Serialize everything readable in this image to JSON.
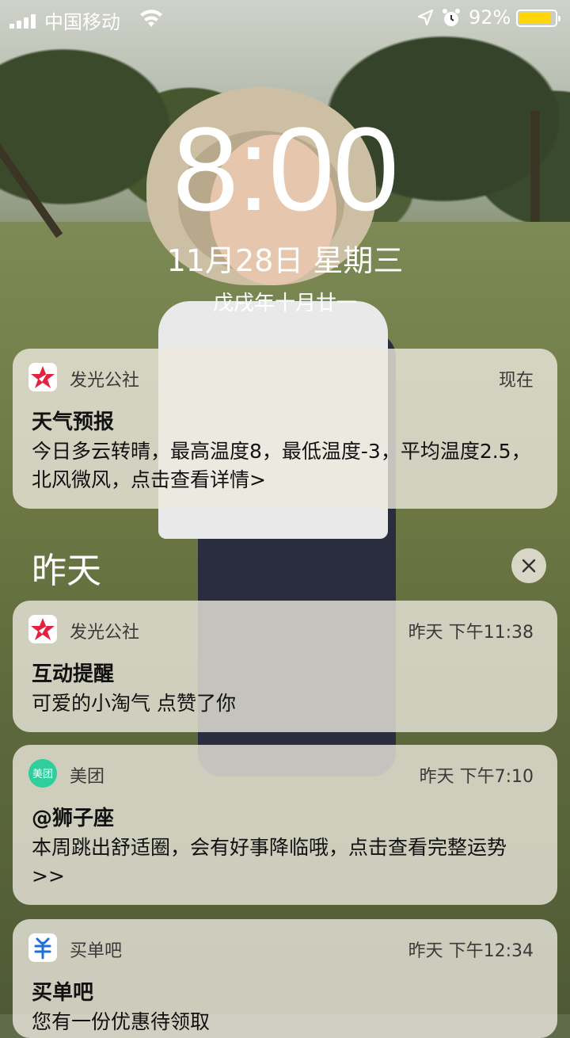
{
  "status_bar": {
    "carrier": "中国移动",
    "battery_percent": "92%",
    "battery_level": 0.92,
    "icons": [
      "signal-icon",
      "wifi-icon",
      "location-icon",
      "alarm-icon",
      "battery-icon"
    ]
  },
  "lock": {
    "time": "8:00",
    "date": "11月28日 星期三",
    "lunar": "戊戌年十月廿一"
  },
  "notifications_today": [
    {
      "app": "发光公社",
      "time": "现在",
      "title": "天气预报",
      "body": "今日多云转晴，最高温度8，最低温度-3，平均温度2.5，北风微风，点击查看详情>"
    }
  ],
  "section_yesterday": "昨天",
  "notifications_yesterday": [
    {
      "app": "发光公社",
      "time": "昨天 下午11:38",
      "title": "互动提醒",
      "body": "可爱的小淘气 点赞了你"
    },
    {
      "app": "美团",
      "time": "昨天 下午7:10",
      "title": "@狮子座",
      "body": "本周跳出舒适圈，会有好事降临哦，点击查看完整运势>>"
    },
    {
      "app": "买单吧",
      "time": "昨天 下午12:34",
      "title": "买单吧",
      "body": "您有一份优惠待领取"
    }
  ],
  "colors": {
    "battery_fill": "#ffd60a",
    "star_red": "#e6213f",
    "meituan_green": "#2ecf9c",
    "maidanba_blue": "#1f6fd6"
  }
}
